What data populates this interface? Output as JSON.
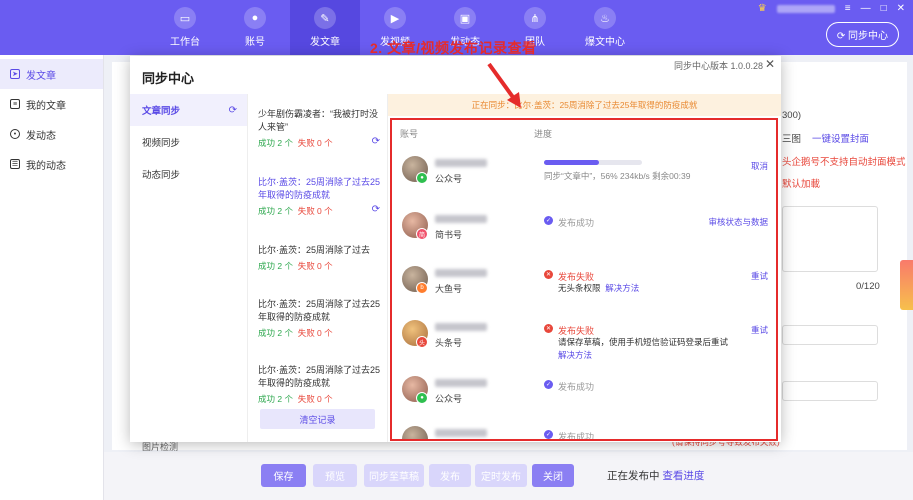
{
  "topbar": {
    "nav": [
      {
        "label": "工作台",
        "icon": "monitor-icon"
      },
      {
        "label": "账号",
        "icon": "user-icon"
      },
      {
        "label": "发文章",
        "icon": "feather-icon",
        "active": true
      },
      {
        "label": "发视频",
        "icon": "play-icon"
      },
      {
        "label": "发动态",
        "icon": "image-icon"
      },
      {
        "label": "团队",
        "icon": "team-icon"
      },
      {
        "label": "爆文中心",
        "icon": "fire-icon"
      }
    ],
    "sync_button": "同步中心",
    "window_controls": [
      "≡",
      "—",
      "□",
      "✕"
    ]
  },
  "leftnav": {
    "items": [
      {
        "label": "发文章",
        "active": true
      },
      {
        "label": "我的文章"
      },
      {
        "label": "发动态"
      },
      {
        "label": "我的动态"
      }
    ]
  },
  "background": {
    "count_hint": "300)",
    "cover_opt_a": "三图",
    "cover_opt_b": "一键设置封面",
    "warn_a": "头企鹅号不支持自动封面模式",
    "warn_b": "默认加載",
    "char_count": "0/120",
    "bottom_warn": "(请保持同步号导致发布失败)",
    "bottom_left": "图片检测"
  },
  "bottombar": {
    "buttons": [
      "保存",
      "预览",
      "同步至草稿",
      "发布",
      "定时发布",
      "关闭"
    ],
    "status_prefix": "正在发布中",
    "status_link": "查看进度"
  },
  "modal": {
    "title": "同步中心",
    "version": "同步中心版本 1.0.0.28",
    "close": "✕",
    "sidebar": [
      {
        "label": "文章同步",
        "active": true
      },
      {
        "label": "视频同步"
      },
      {
        "label": "动态同步"
      }
    ],
    "records": [
      {
        "title": "少年剧伤霸凌者：“我被打时没人来管”",
        "ok": "成功 2 个",
        "fail": "失败 0 个",
        "active": false,
        "refresh": true
      },
      {
        "title": "比尔·盖茨：25周消除了过去25年取得的防疫成就",
        "ok": "成功 2 个",
        "fail": "失败 0 个",
        "active": true,
        "refresh": true
      },
      {
        "title": "比尔·盖茨：25周消除了过去",
        "ok": "成功 2 个",
        "fail": "失败 0 个",
        "active": false,
        "refresh": false
      },
      {
        "title": "比尔·盖茨：25周消除了过去25年取得的防疫成就",
        "ok": "成功 2 个",
        "fail": "失败 0 个",
        "active": false,
        "refresh": false
      },
      {
        "title": "比尔·盖茨：25周消除了过去25年取得的防疫成就",
        "ok": "成功 2 个",
        "fail": "失败 0 个",
        "active": false,
        "refresh": false
      }
    ],
    "clear_button": "清空记录",
    "notice": "正在同步：比尔·盖茨：25周消除了过去25年取得的防疫成就",
    "col_account": "账号",
    "col_progress": "进度",
    "rows": [
      {
        "platform": "公众号",
        "badge": "green",
        "kind": "progress",
        "progress": 0.56,
        "text": "同步“文章中”，56% 234kb/s 剩余00:39",
        "action": "取消"
      },
      {
        "platform": "简书号",
        "badge": "pink",
        "kind": "ok",
        "text": "发布成功",
        "action": "审核状态与数据"
      },
      {
        "platform": "大鱼号",
        "badge": "orange",
        "kind": "err",
        "text": "发布失败",
        "sub": "无头条权限",
        "sub_link": "解决方法",
        "action": "重试"
      },
      {
        "platform": "头条号",
        "badge": "red",
        "kind": "err",
        "text": "发布失败",
        "sub": "请保存草稿，使用手机短信验证码登录后重试",
        "sub_link": "解决方法",
        "action": "重试"
      },
      {
        "platform": "公众号",
        "badge": "green",
        "kind": "ok",
        "text": "发布成功",
        "action": ""
      },
      {
        "platform": "",
        "badge": "",
        "kind": "ok",
        "text": "发布成功",
        "action": ""
      }
    ]
  },
  "annotation": {
    "text": "2. 文章/视频发布记录查看",
    "color": "#e52b2b"
  },
  "colors": {
    "brand": "#6a5cf1",
    "success": "#2fa84f",
    "error": "#e8473b",
    "notice": "#e98a33"
  }
}
